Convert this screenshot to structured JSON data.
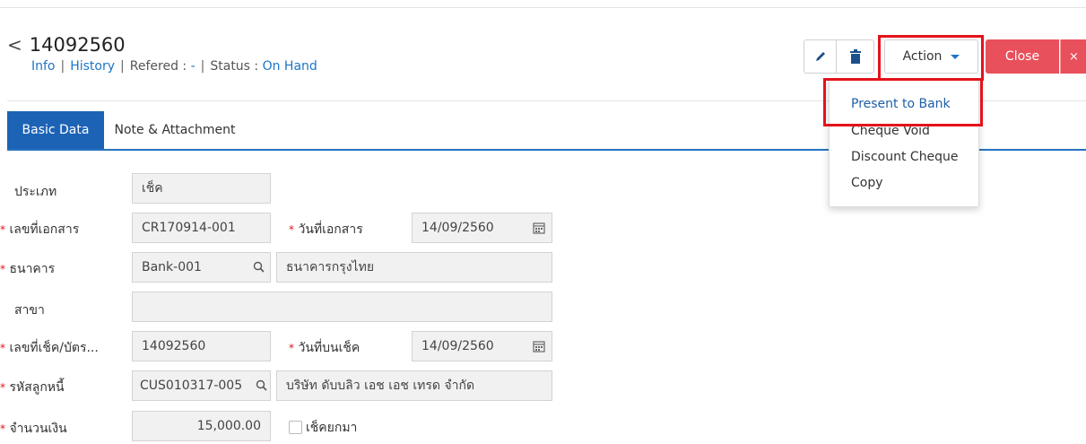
{
  "header": {
    "doc_number": "14092560",
    "info_link": "Info",
    "history_link": "History",
    "refered_label": "Refered :",
    "refered_value": "-",
    "status_label": "Status :",
    "status_value": "On Hand",
    "separator": "|"
  },
  "toolbar": {
    "action_label": "Action",
    "close_label": "Close",
    "close_x": "×"
  },
  "action_menu": {
    "items": [
      "Present to Bank",
      "Cheque Void",
      "Discount Cheque",
      "Copy"
    ]
  },
  "tabs": [
    "Basic Data",
    "Note & Attachment"
  ],
  "form": {
    "required_mark": "*",
    "type_label": "ประเภท",
    "type_value": "เช็ค",
    "doc_no_label": "เลขที่เอกสาร",
    "doc_no_value": "CR170914-001",
    "doc_date_label": "วันที่เอกสาร",
    "doc_date_value": "14/09/2560",
    "bank_label": "ธนาคาร",
    "bank_code": "Bank-001",
    "bank_name": "ธนาคารกรุงไทย",
    "branch_label": "สาขา",
    "branch_value": "",
    "cheque_no_label": "เลขที่เช็ค/บัตร...",
    "cheque_no_value": "14092560",
    "cheque_date_label": "วันที่บนเช็ค",
    "cheque_date_value": "14/09/2560",
    "customer_label": "รหัสลูกหนี้",
    "customer_code": "CUS010317-005",
    "customer_name": "บริษัท ดับบลิว เอช เอช เทรด จำกัด",
    "amount_label": "จำนวนเงิน",
    "amount_value": "15,000.00",
    "returned_cheque_label": "เช็คยกมา"
  },
  "colors": {
    "link": "#1e74c7",
    "tab_active": "#1d63b5",
    "close_button": "#e8505b",
    "highlight": "#e3131b"
  },
  "icons": [
    "chevron-left-icon",
    "pencil-icon",
    "trash-icon",
    "caret-down-icon",
    "search-icon",
    "calendar-icon"
  ]
}
